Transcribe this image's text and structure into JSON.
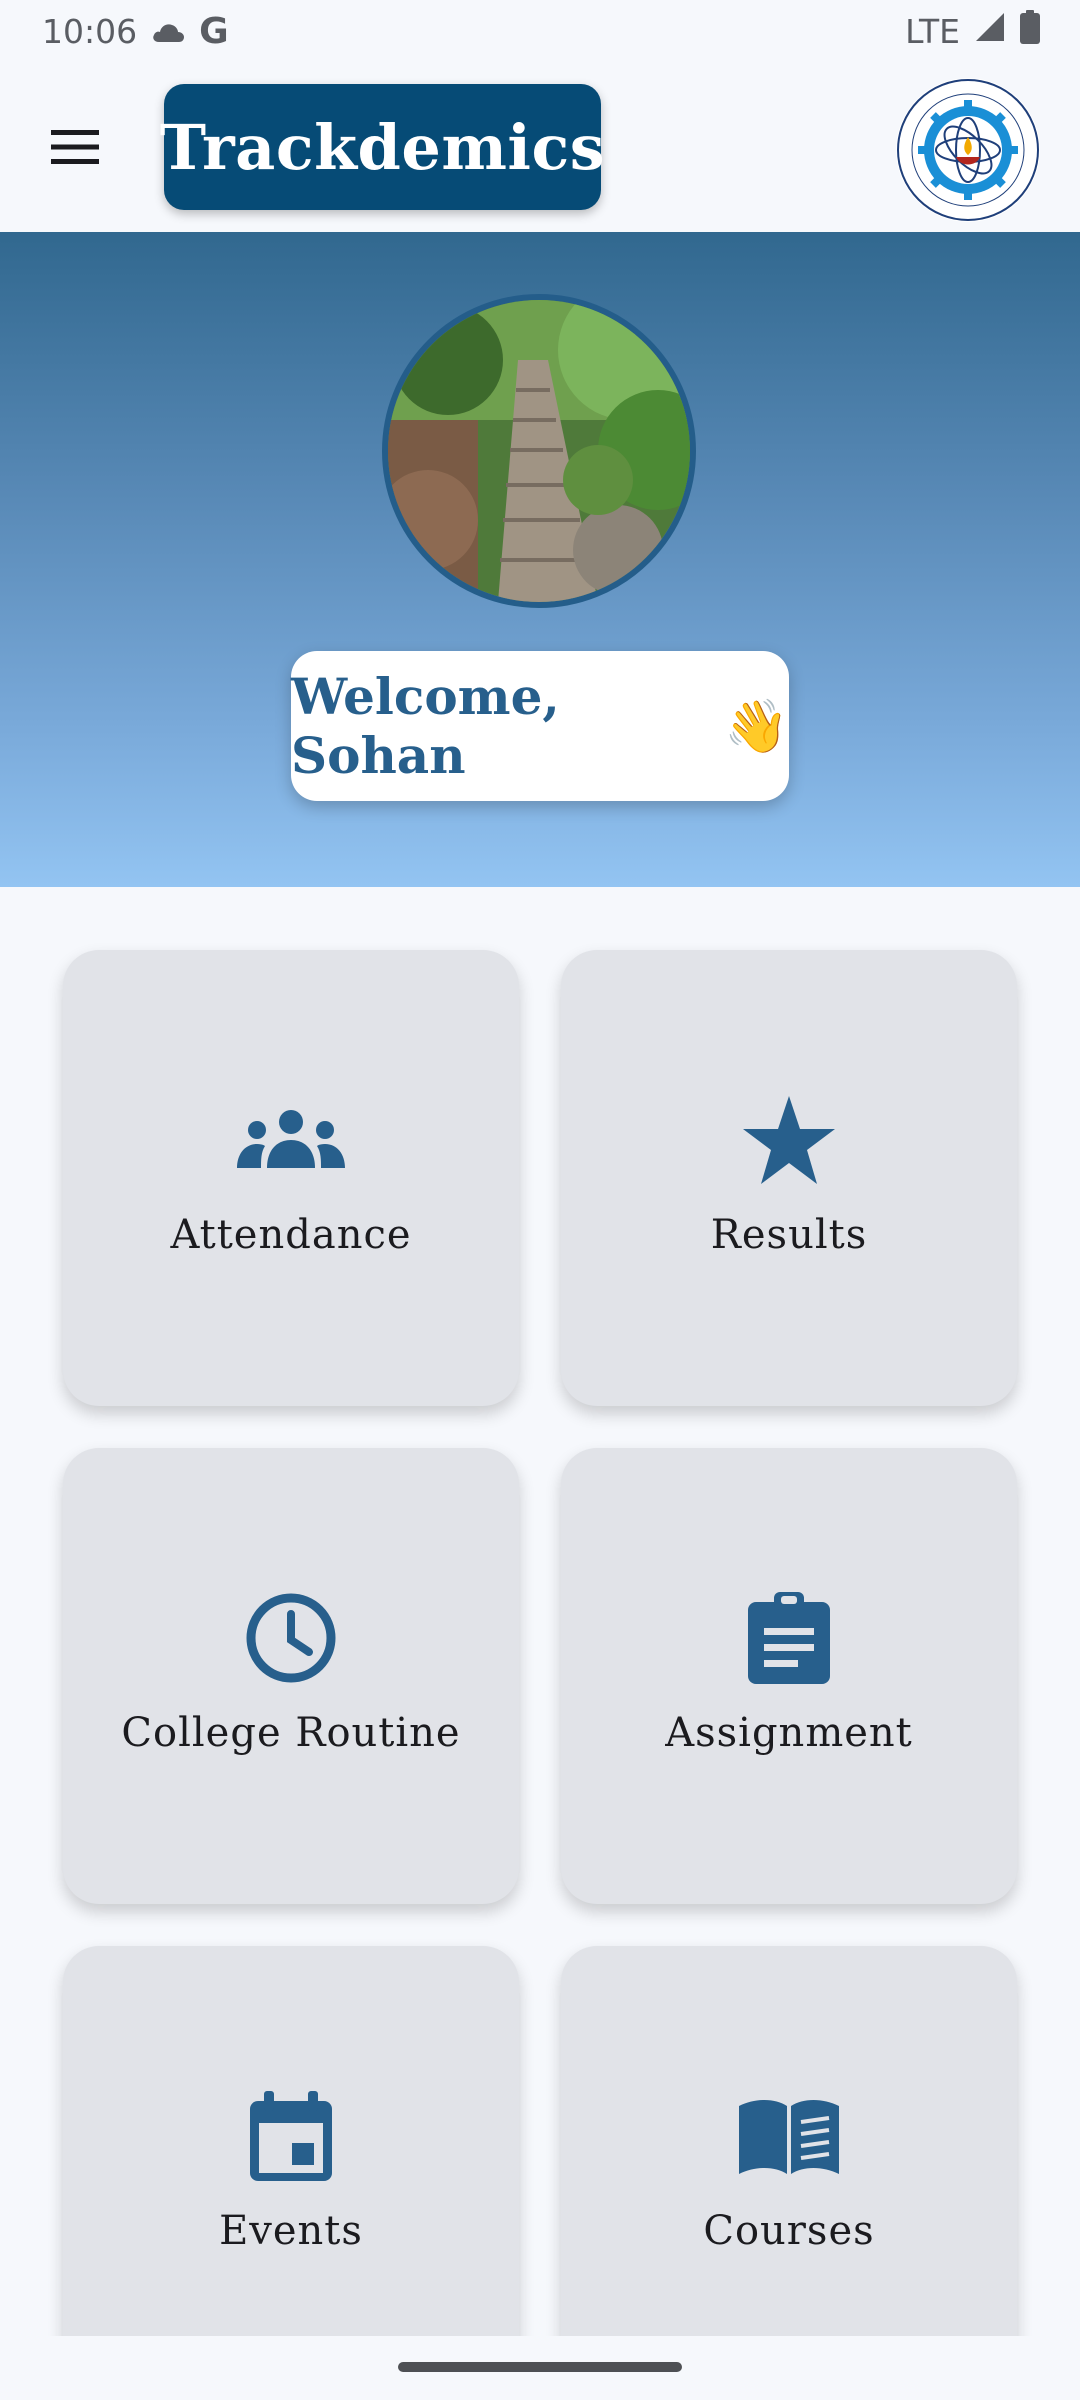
{
  "status_bar": {
    "time": "10:06",
    "network": "LTE",
    "icons": [
      "cloud-icon",
      "google-g-icon",
      "signal-icon",
      "battery-icon"
    ],
    "google_glyph": "G"
  },
  "app_bar": {
    "title": "Trackdemics",
    "menu_icon": "hamburger-menu-icon",
    "logo": "institute-logo"
  },
  "hero": {
    "welcome_text": "Welcome, Sohan",
    "wave_emoji": "👋"
  },
  "tiles": [
    {
      "label": "Attendance",
      "icon": "group-icon"
    },
    {
      "label": "Results",
      "icon": "star-icon"
    },
    {
      "label": "College Routine",
      "icon": "clock-icon"
    },
    {
      "label": "Assignment",
      "icon": "clipboard-icon"
    },
    {
      "label": "Events",
      "icon": "calendar-icon"
    },
    {
      "label": "Courses",
      "icon": "book-icon"
    }
  ],
  "colors": {
    "primary": "#064b76",
    "icon": "#275f8c",
    "tile_bg": "#e1e3e8",
    "page_bg": "#f6f8fc"
  }
}
